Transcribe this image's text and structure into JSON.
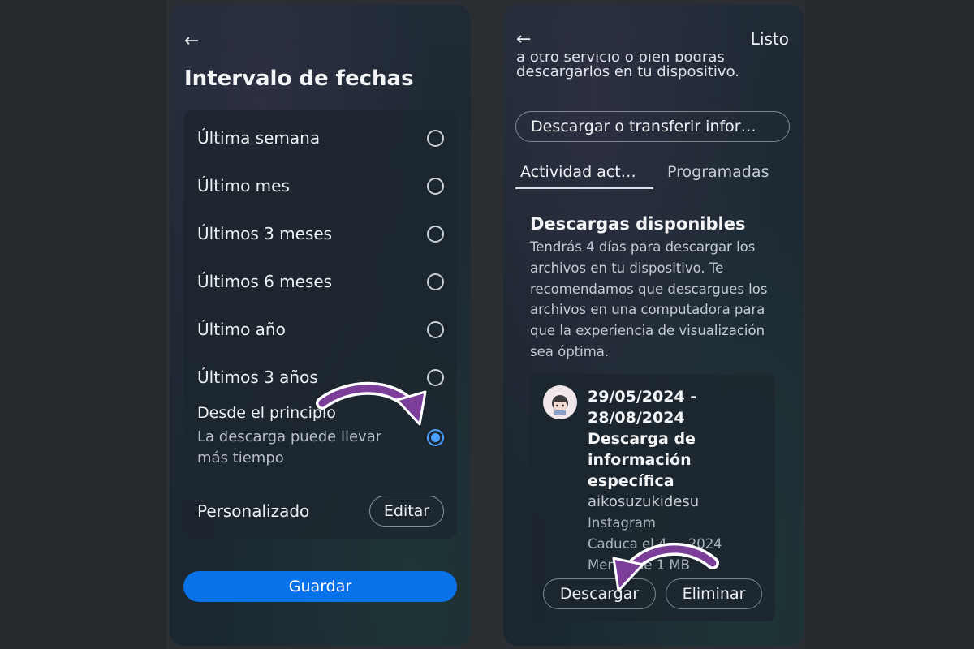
{
  "left_screen": {
    "back_icon": "arrow-left-icon",
    "title": "Intervalo de fechas",
    "options": [
      {
        "label": "Última semana",
        "selected": false
      },
      {
        "label": "Último mes",
        "selected": false
      },
      {
        "label": "Últimos 3 meses",
        "selected": false
      },
      {
        "label": "Últimos 6 meses",
        "selected": false
      },
      {
        "label": "Último año",
        "selected": false
      },
      {
        "label": "Últimos 3 años",
        "selected": false
      }
    ],
    "from_start": {
      "label": "Desde el principio",
      "sublabel": "La descarga puede llevar más tiempo",
      "selected": true
    },
    "custom": {
      "label": "Personalizado",
      "edit_label": "Editar"
    },
    "save_label": "Guardar"
  },
  "right_screen": {
    "back_icon": "arrow-left-icon",
    "done_label": "Listo",
    "cut_line": "a otro servicio o bien podrás",
    "intro_line": "descargarlos en tu dispositivo.",
    "transfer_button": "Descargar o transferir infor…",
    "tabs": [
      {
        "label": "Actividad act…",
        "active": true
      },
      {
        "label": "Programadas",
        "active": false
      }
    ],
    "downloads_title": "Descargas disponibles",
    "downloads_desc": "Tendrás 4 días para descargar los archivos en tu dispositivo. Te recomendamos que descargues los archivos en una computadora para que la experiencia de visualización sea óptima.",
    "card": {
      "date_range": "29/05/2024 - 28/08/2024",
      "name": "Descarga de información específica",
      "username": "aikosuzukidesu",
      "platform": "Instagram",
      "expires": "Caduca el 4 ... 2024",
      "size": "Menos de 1 MB",
      "download_label": "Descargar",
      "delete_label": "Eliminar"
    }
  },
  "colors": {
    "accent_blue": "#0a72e8",
    "radio_selected": "#4aa0ff",
    "annotation_arrow": "#7b3f9a"
  }
}
